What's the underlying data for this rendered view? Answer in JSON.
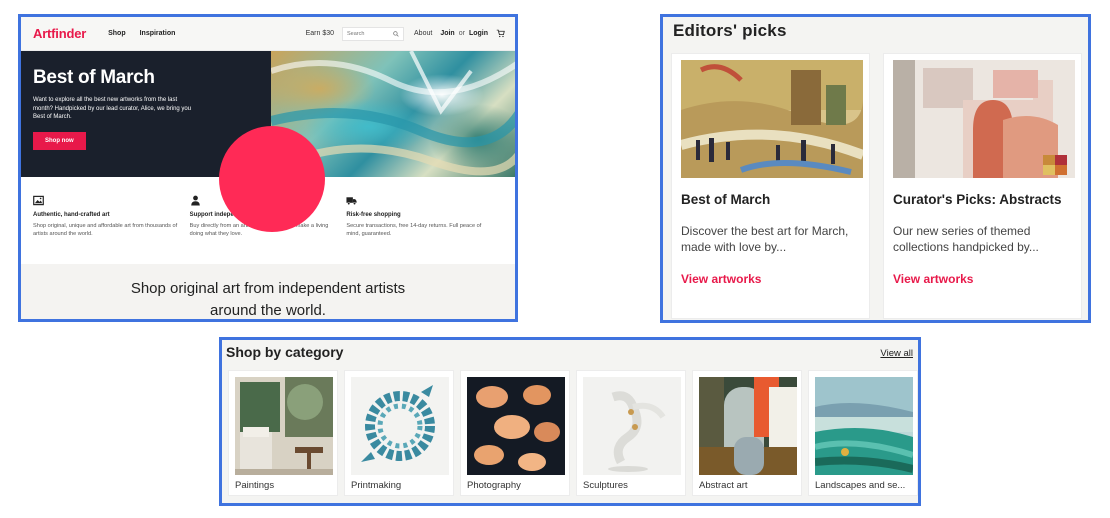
{
  "homepage": {
    "nav": {
      "logo": "Artfinder",
      "shop": "Shop",
      "inspiration": "Inspiration",
      "earn": "Earn $30",
      "search_placeholder": "Search",
      "about": "About",
      "join": "Join",
      "or": "or",
      "login": "Login"
    },
    "hero": {
      "title": "Best of March",
      "text": "Want to explore all the best new artworks from the last month? Handpicked by our lead curator, Alice, we bring you Best of March.",
      "button": "Shop now"
    },
    "features": [
      {
        "icon": "image-icon",
        "title": "Authentic, hand-crafted art",
        "desc": "Shop original, unique and affordable art from thousands of artists around the world."
      },
      {
        "icon": "person-icon",
        "title": "Support independent artists",
        "desc": "Buy directly from an artist, helping them to make a living doing what they love."
      },
      {
        "icon": "truck-icon",
        "title": "Risk-free shopping",
        "desc": "Secure transactions, free 14-day returns. Full peace of mind, guaranteed."
      }
    ],
    "tagline": "Shop original art from independent artists around the world."
  },
  "editors_picks": {
    "title": "Editors' picks",
    "cards": [
      {
        "name": "Best of March",
        "desc": "Discover the best art for March, made with love by...",
        "link": "View artworks"
      },
      {
        "name": "Curator's Picks: Abstracts",
        "desc": "Our new series of themed collections handpicked by...",
        "link": "View artworks"
      }
    ]
  },
  "categories": {
    "title": "Shop by category",
    "view_all": "View all",
    "items": [
      {
        "label": "Paintings"
      },
      {
        "label": "Printmaking"
      },
      {
        "label": "Photography"
      },
      {
        "label": "Sculptures"
      },
      {
        "label": "Abstract art"
      },
      {
        "label": "Landscapes and se..."
      }
    ]
  },
  "colors": {
    "brand": "#e8194a",
    "hero_dark": "#1a202c",
    "highlight_border": "#3f73df"
  }
}
